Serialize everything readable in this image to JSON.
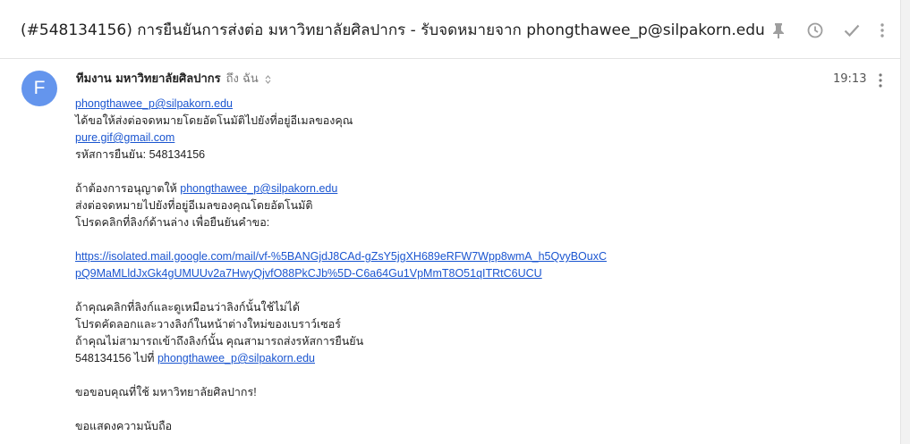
{
  "subject": "(#548134156) การยืนยันการส่งต่อ มหาวิทยาลัยศิลปากร - รับจดหมายจาก phongthawee_p@silpakorn.edu",
  "header_icons": [
    "pin-icon",
    "snooze-clock-icon",
    "check-done-icon",
    "more-vert-icon"
  ],
  "message": {
    "avatar_letter": "F",
    "avatar_color": "#6495ed",
    "sender_name": "ทีมงาน มหาวิทยาลัยศิลปากร",
    "to_label": "ถึง ฉัน",
    "time": "19:13",
    "body": {
      "p1_email": "phongthawee_p@silpakorn.edu",
      "p1_text": "ได้ขอให้ส่งต่อจดหมายโดยอัตโนมัติไปยังที่อยู่อีเมลของคุณ",
      "p1_target_email": "pure.gif@gmail.com",
      "p1_code_label": "รหัสการยืนยัน: 548134156",
      "p2_prefix": "ถ้าต้องการอนุญาตให้ ",
      "p2_email": "phongthawee_p@silpakorn.edu",
      "p2_line2": "ส่งต่อจดหมายไปยังที่อยู่อีเมลของคุณโดยอัตโนมัติ",
      "p2_line3": "โปรดคลิกที่ลิงก์ด้านล่าง เพื่อยืนยันคำขอ:",
      "link_line1": "https://isolated.mail.google.com/mail/vf-%5BANGjdJ8CAd-gZsY5jgXH689eRFW7Wpp8wmA_h5QvyBOuxC",
      "link_line2": "pQ9MaMLldJxGk4gUMUUv2a7HwyQjvfO88PkCJb%5D-C6a64Gu1VpMmT8O51qITRtC6UCU",
      "p3_line1": "ถ้าคุณคลิกที่ลิงก์และดูเหมือนว่าลิงก์นั้นใช้ไม่ได้",
      "p3_line2": "โปรดคัดลอกและวางลิงก์ในหน้าต่างใหม่ของเบราว์เซอร์",
      "p3_line3": "ถ้าคุณไม่สามารถเข้าถึงลิงก์นั้น คุณสามารถส่งรหัสการยืนยัน",
      "p3_code_prefix": "548134156 ไปที่ ",
      "p3_email": "phongthawee_p@silpakorn.edu",
      "thanks": "ขอขอบคุณที่ใช้ มหาวิทยาลัยศิลปากร!",
      "closing": "ขอแสดงความนับถือ"
    }
  }
}
